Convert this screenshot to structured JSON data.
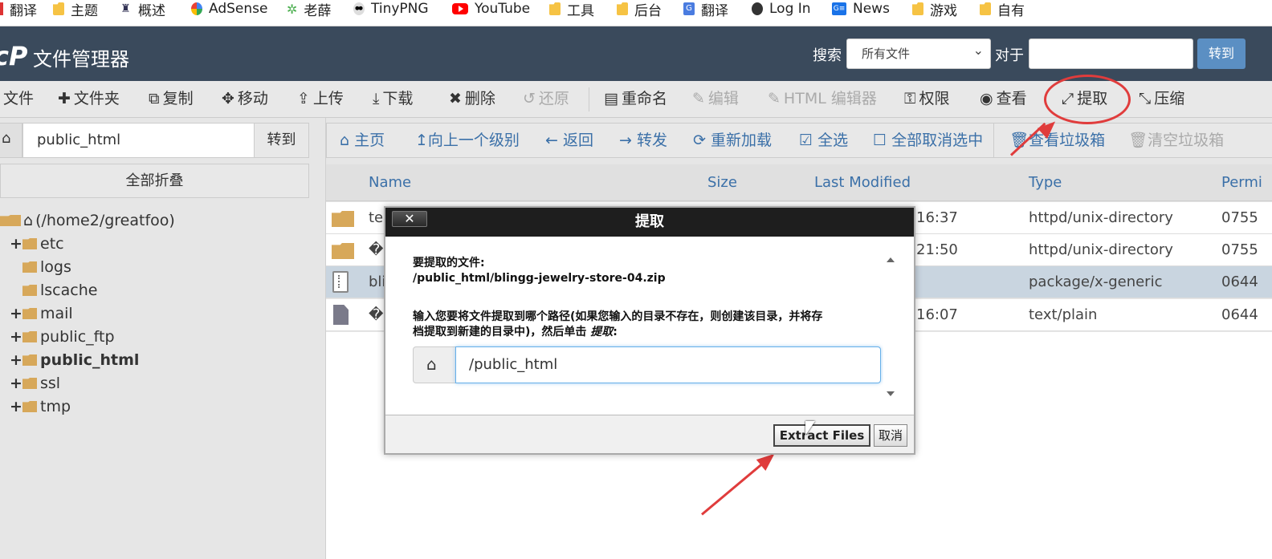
{
  "bookmarks": [
    {
      "label": "翻译",
      "icon": "bookmark-icon"
    },
    {
      "label": "主题",
      "icon": "folder-icon"
    },
    {
      "label": "概述",
      "icon": "site-icon"
    },
    {
      "label": "AdSense",
      "icon": "google-icon"
    },
    {
      "label": "老薛",
      "icon": "leaf-icon"
    },
    {
      "label": "TinyPNG",
      "icon": "panda-icon"
    },
    {
      "label": "YouTube",
      "icon": "youtube-icon"
    },
    {
      "label": "工具",
      "icon": "folder-icon"
    },
    {
      "label": "后台",
      "icon": "folder-icon"
    },
    {
      "label": "翻译",
      "icon": "translate-icon"
    },
    {
      "label": "Log In",
      "icon": "globe-icon"
    },
    {
      "label": "News",
      "icon": "news-icon"
    },
    {
      "label": "游戏",
      "icon": "folder-icon"
    },
    {
      "label": "自有",
      "icon": "folder-icon"
    }
  ],
  "header": {
    "logo": "cP",
    "title": "文件管理器",
    "search_label": "搜索",
    "search_scope": "所有文件",
    "for_label": "对于",
    "search_value": "",
    "go_label": "转到",
    "bg_color": "#3a4a5c"
  },
  "toolbar": [
    {
      "label": "文件",
      "icon": "plus-icon",
      "disabled": false
    },
    {
      "label": "文件夹",
      "icon": "plus-icon",
      "disabled": false
    },
    {
      "label": "复制",
      "icon": "copy-icon",
      "disabled": false
    },
    {
      "label": "移动",
      "icon": "move-icon",
      "disabled": false
    },
    {
      "label": "上传",
      "icon": "upload-icon",
      "disabled": false
    },
    {
      "label": "下载",
      "icon": "download-icon",
      "disabled": false
    },
    {
      "label": "删除",
      "icon": "delete-icon",
      "disabled": false
    },
    {
      "label": "还原",
      "icon": "restore-icon",
      "disabled": true
    },
    {
      "label": "重命名",
      "icon": "rename-icon",
      "disabled": false
    },
    {
      "label": "编辑",
      "icon": "pencil-icon",
      "disabled": true
    },
    {
      "label": "HTML 编辑器",
      "icon": "html-editor-icon",
      "disabled": true
    },
    {
      "label": "权限",
      "icon": "key-icon",
      "disabled": false
    },
    {
      "label": "查看",
      "icon": "eye-icon",
      "disabled": false
    },
    {
      "label": "提取",
      "icon": "expand-icon",
      "disabled": false
    },
    {
      "label": "压缩",
      "icon": "compress-icon",
      "disabled": false
    }
  ],
  "path_bar": {
    "value": "public_html",
    "go_label": "转到",
    "collapse_label": "全部折叠"
  },
  "tree": [
    {
      "label": "(/home2/greatfoo)",
      "level": 0,
      "expander": "",
      "bold": false
    },
    {
      "label": "etc",
      "level": 1,
      "expander": "+",
      "bold": false
    },
    {
      "label": "logs",
      "level": 2,
      "expander": "",
      "bold": false
    },
    {
      "label": "lscache",
      "level": 2,
      "expander": "",
      "bold": false
    },
    {
      "label": "mail",
      "level": 1,
      "expander": "+",
      "bold": false
    },
    {
      "label": "public_ftp",
      "level": 1,
      "expander": "+",
      "bold": false
    },
    {
      "label": "public_html",
      "level": 1,
      "expander": "+",
      "bold": true
    },
    {
      "label": "ssl",
      "level": 1,
      "expander": "+",
      "bold": false
    },
    {
      "label": "tmp",
      "level": 1,
      "expander": "+",
      "bold": false
    }
  ],
  "navbar": [
    {
      "label": "主页",
      "icon": "home-icon",
      "disabled": false
    },
    {
      "label": "向上一个级别",
      "icon": "level-up-icon",
      "disabled": false
    },
    {
      "label": "返回",
      "icon": "arrow-left-icon",
      "disabled": false
    },
    {
      "label": "转发",
      "icon": "arrow-right-icon",
      "disabled": false
    },
    {
      "label": "重新加载",
      "icon": "refresh-icon",
      "disabled": false
    },
    {
      "label": "全选",
      "icon": "checkbox-checked-icon",
      "disabled": false
    },
    {
      "label": "全部取消选中",
      "icon": "checkbox-empty-icon",
      "disabled": false
    },
    {
      "label": "查看垃圾箱",
      "icon": "trash-icon",
      "disabled": false
    },
    {
      "label": "清空垃圾箱",
      "icon": "trash-icon",
      "disabled": true
    }
  ],
  "table": {
    "columns": [
      "Name",
      "Size",
      "Last Modified",
      "Type",
      "Permi"
    ],
    "rows": [
      {
        "name": "tes",
        "modified": "16:37",
        "type": "httpd/unix-directory",
        "perm": "0755",
        "icon": "folder-icon",
        "selected": false
      },
      {
        "name": "�",
        "modified": "21:50",
        "type": "httpd/unix-directory",
        "perm": "0755",
        "icon": "folder-icon",
        "selected": false
      },
      {
        "name": "bli",
        "modified": "",
        "type": "package/x-generic",
        "perm": "0644",
        "icon": "zip-file-icon",
        "selected": true
      },
      {
        "name": "�",
        "modified": "16:07",
        "type": "text/plain",
        "perm": "0644",
        "icon": "text-file-icon",
        "selected": false
      }
    ]
  },
  "modal": {
    "title": "提取",
    "close_label": "✕",
    "file_label": "要提取的文件:",
    "file_path": "/public_html/blingg-jewelry-store-04.zip",
    "instruction_line1": "输入您要将文件提取到哪个路径(如果您输入的目录不存在，则创建该目录，并将存",
    "instruction_line2": "档提取到新建的目录中)，然后单击 ",
    "instruction_action": "提取",
    "instruction_end": ":",
    "dest_value": "/public_html",
    "extract_label": "Extract Files",
    "cancel_label": "取消"
  },
  "annotation_color": "#e03c3c"
}
